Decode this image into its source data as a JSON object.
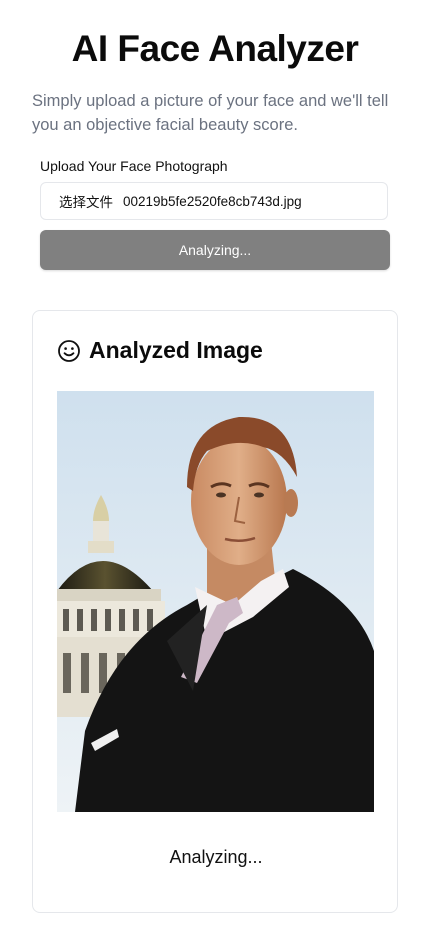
{
  "app": {
    "title": "AI Face Analyzer",
    "subtitle": "Simply upload a picture of your face and we'll tell you an objective facial beauty score."
  },
  "upload": {
    "label": "Upload Your Face Photograph",
    "file_button_label": "选择文件",
    "file_name": "00219b5fe2520fe8cb743d.jpg",
    "analyze_button_label": "Analyzing..."
  },
  "result_card": {
    "title": "Analyzed Image",
    "icon": "smile-icon",
    "status": "Analyzing..."
  },
  "colors": {
    "button_bg": "#808080",
    "subtitle_text": "#6b7280",
    "border": "#e5e7eb",
    "sky": "#dfe9f3",
    "suit": "#141414",
    "skin": "#d9a27c",
    "hair": "#8a4a2a"
  }
}
